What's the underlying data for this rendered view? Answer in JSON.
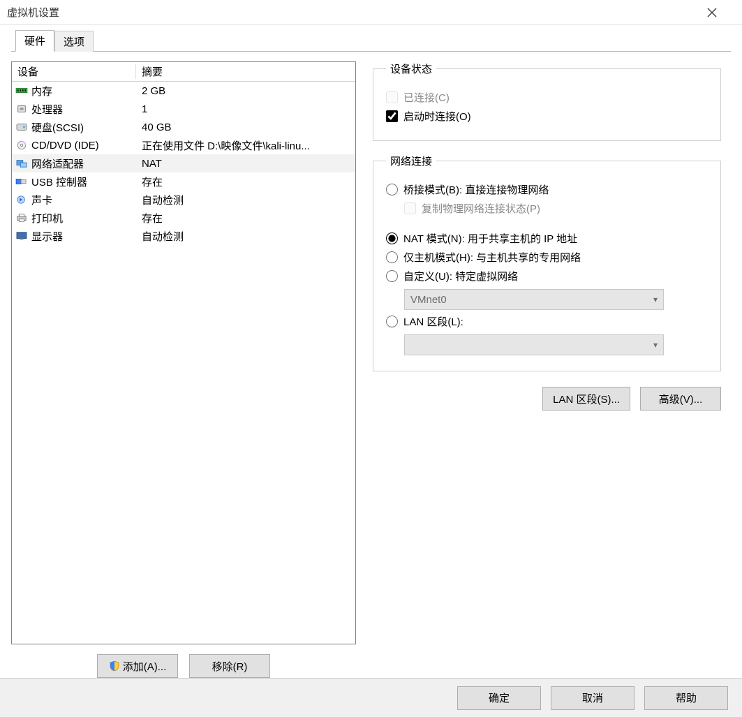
{
  "window": {
    "title": "虚拟机设置"
  },
  "tabs": {
    "hardware": "硬件",
    "options": "选项"
  },
  "table": {
    "header_device": "设备",
    "header_summary": "摘要",
    "rows": [
      {
        "icon": "memory",
        "name": "内存",
        "summary": "2 GB"
      },
      {
        "icon": "cpu",
        "name": "处理器",
        "summary": "1"
      },
      {
        "icon": "disk",
        "name": "硬盘(SCSI)",
        "summary": "40 GB"
      },
      {
        "icon": "cd",
        "name": "CD/DVD (IDE)",
        "summary": "正在使用文件 D:\\映像文件\\kali-linu..."
      },
      {
        "icon": "net",
        "name": "网络适配器",
        "summary": "NAT"
      },
      {
        "icon": "usb",
        "name": "USB 控制器",
        "summary": "存在"
      },
      {
        "icon": "sound",
        "name": "声卡",
        "summary": "自动检测"
      },
      {
        "icon": "printer",
        "name": "打印机",
        "summary": "存在"
      },
      {
        "icon": "display",
        "name": "显示器",
        "summary": "自动检测"
      }
    ],
    "selected_index": 4
  },
  "left_buttons": {
    "add": "添加(A)...",
    "remove": "移除(R)"
  },
  "device_state": {
    "legend": "设备状态",
    "connected": "已连接(C)",
    "connect_on_start": "启动时连接(O)"
  },
  "network": {
    "legend": "网络连接",
    "bridged": "桥接模式(B): 直接连接物理网络",
    "replicate": "复制物理网络连接状态(P)",
    "nat": "NAT 模式(N): 用于共享主机的 IP 地址",
    "hostonly": "仅主机模式(H): 与主机共享的专用网络",
    "custom": "自定义(U): 特定虚拟网络",
    "custom_value": "VMnet0",
    "lanseg": "LAN 区段(L):",
    "lanseg_value": ""
  },
  "right_buttons": {
    "lan_segments": "LAN 区段(S)...",
    "advanced": "高级(V)..."
  },
  "footer": {
    "ok": "确定",
    "cancel": "取消",
    "help": "帮助"
  }
}
